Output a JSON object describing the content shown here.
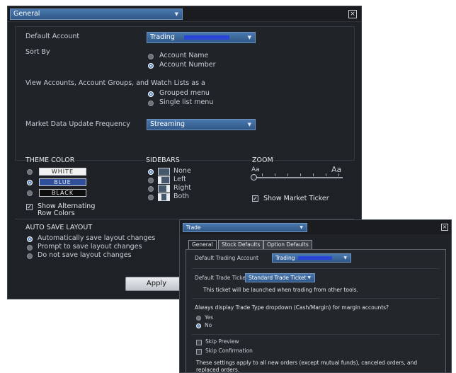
{
  "main_dialog": {
    "section_select": "General",
    "close_label": "×",
    "default_account_label": "Default Account",
    "default_account_value": "Trading",
    "sort_by_label": "Sort By",
    "sort_options": [
      "Account Name",
      "Account Number"
    ],
    "sort_selected": "Account Number",
    "view_label": "View Accounts, Account Groups, and Watch Lists as a",
    "view_options": [
      "Grouped menu",
      "Single list menu"
    ],
    "view_selected": "Grouped menu",
    "market_data_label": "Market Data Update Frequency",
    "market_data_value": "Streaming",
    "theme_color_header": "THEME COLOR",
    "theme_options": [
      "WHITE",
      "BLUE",
      "BLACK"
    ],
    "theme_selected": "BLUE",
    "sidebars_header": "SIDEBARS",
    "sidebar_options": [
      "None",
      "Left",
      "Right",
      "Both"
    ],
    "sidebar_selected": "None",
    "zoom_header": "ZOOM",
    "zoom_small": "Aa",
    "zoom_large": "Aa",
    "zoom_level": 0,
    "alt_rows_label_1": "Show Alternating",
    "alt_rows_label_2": "Row Colors",
    "alt_rows_checked": true,
    "show_ticker_label": "Show Market Ticker",
    "show_ticker_checked": true,
    "auto_save_header": "AUTO SAVE LAYOUT",
    "auto_save_options": [
      "Automatically save layout changes",
      "Prompt to save layout changes",
      "Do not save layout changes"
    ],
    "auto_save_selected": "Automatically save layout changes",
    "apply_label": "Apply"
  },
  "trade_dialog": {
    "section_select": "Trade",
    "close_label": "×",
    "tabs": [
      "General",
      "Stock Defaults",
      "Option Defaults"
    ],
    "active_tab": "General",
    "default_trading_account_label": "Default Trading Account",
    "default_trading_account_value": "Trading",
    "default_ticket_label": "Default Trade Ticket",
    "default_ticket_value": "Standard Trade Ticket",
    "ticket_note": "This ticket will be launched when trading from other tools.",
    "trade_type_question": "Always display Trade Type dropdown (Cash/Margin) for margin accounts?",
    "trade_type_options": [
      "Yes",
      "No"
    ],
    "trade_type_selected": "No",
    "skip_preview_label": "Skip Preview",
    "skip_confirmation_label": "Skip Confirmation",
    "footnote_1": "These settings apply to all new orders (except mutual funds), canceled orders, and",
    "footnote_2": "replaced orders."
  },
  "colors": {
    "accent_blue": "#4a78ad",
    "dialog_bg": "#1e2125",
    "redacted": "#2b44d8"
  }
}
